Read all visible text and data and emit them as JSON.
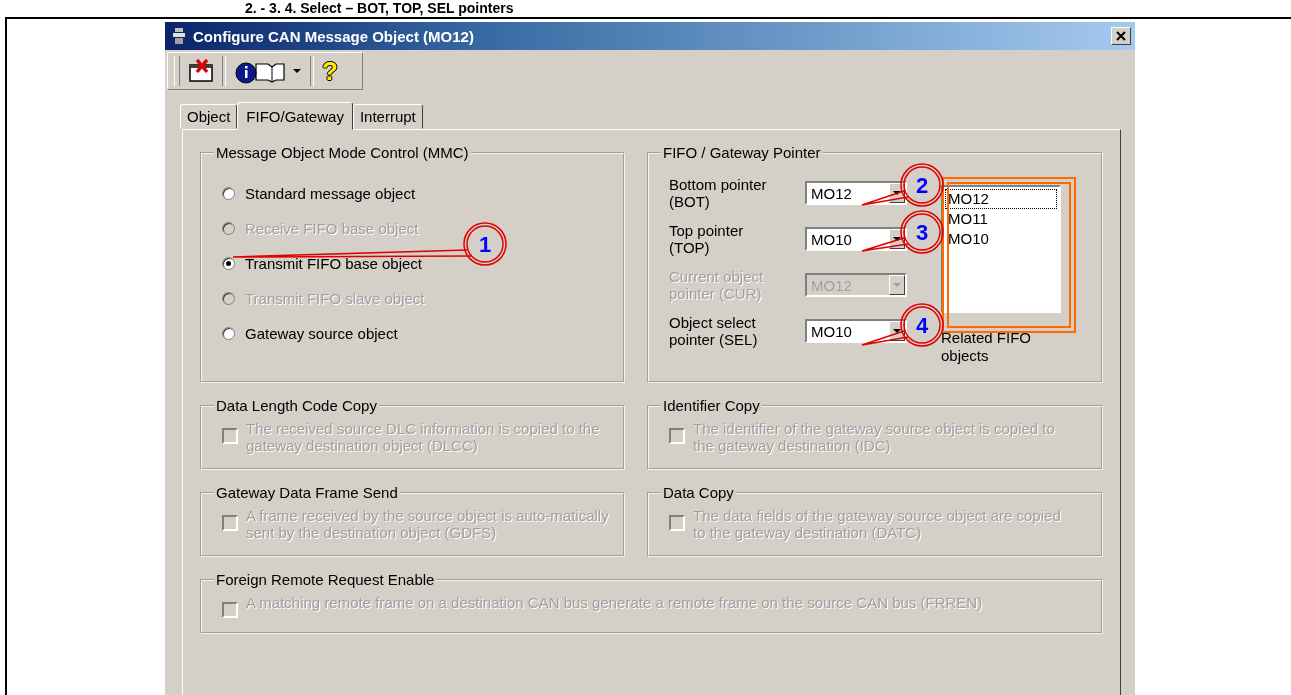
{
  "heading": "2. - 3. 4. Select – BOT, TOP, SEL pointers",
  "window": {
    "title": "Configure CAN Message Object (MO12)"
  },
  "toolbar": {
    "help": "?"
  },
  "tabs": [
    {
      "label": "Object",
      "selected": false
    },
    {
      "label": "FIFO/Gateway",
      "selected": true
    },
    {
      "label": "Interrupt",
      "selected": false
    }
  ],
  "mmc": {
    "title": "Message Object Mode Control (MMC)",
    "options": [
      {
        "label": "Standard message object",
        "selected": false,
        "disabled": false
      },
      {
        "label": "Receive FIFO base object",
        "selected": false,
        "disabled": true
      },
      {
        "label": "Transmit FIFO base object",
        "selected": true,
        "disabled": false
      },
      {
        "label": "Transmit FIFO slave object",
        "selected": false,
        "disabled": true
      },
      {
        "label": "Gateway source object",
        "selected": false,
        "disabled": false
      }
    ]
  },
  "pointer": {
    "title": "FIFO / Gateway Pointer",
    "fields": [
      {
        "label": "Bottom pointer (BOT)",
        "value": "MO12",
        "disabled": false
      },
      {
        "label": "Top pointer (TOP)",
        "value": "MO10",
        "disabled": false
      },
      {
        "label": "Current object pointer (CUR)",
        "value": "MO12",
        "disabled": true
      },
      {
        "label": "Object select pointer (SEL)",
        "value": "MO10",
        "disabled": false
      }
    ],
    "related": {
      "items": [
        {
          "label": "MO12",
          "selected": true
        },
        {
          "label": "MO11",
          "selected": false
        },
        {
          "label": "MO10",
          "selected": false
        }
      ],
      "caption": "Related FIFO objects"
    }
  },
  "options": [
    {
      "title": "Data Length Code Copy",
      "text": "The received source DLC information is copied to the gateway destination object (DLCC)",
      "checked": false,
      "disabled": true
    },
    {
      "title": "Identifier Copy",
      "text": "The identifier of the gateway source object is copied to the gateway destination (IDC)",
      "checked": false,
      "disabled": true
    },
    {
      "title": "Gateway Data Frame Send",
      "text": "A frame received by the source object is auto-matically sent by the destination object (GDFS)",
      "checked": false,
      "disabled": true
    },
    {
      "title": "Data Copy",
      "text": "The data fields of the gateway source object are copied to the gateway destination (DATC)",
      "checked": false,
      "disabled": true
    },
    {
      "title": "Foreign Remote Request Enable",
      "text": "A matching remote frame on a destination CAN bus generate a remote frame on the source CAN bus (FRREN)",
      "checked": false,
      "disabled": true
    }
  ],
  "callouts": [
    {
      "label": "1"
    },
    {
      "label": "2"
    },
    {
      "label": "3"
    },
    {
      "label": "4"
    }
  ]
}
